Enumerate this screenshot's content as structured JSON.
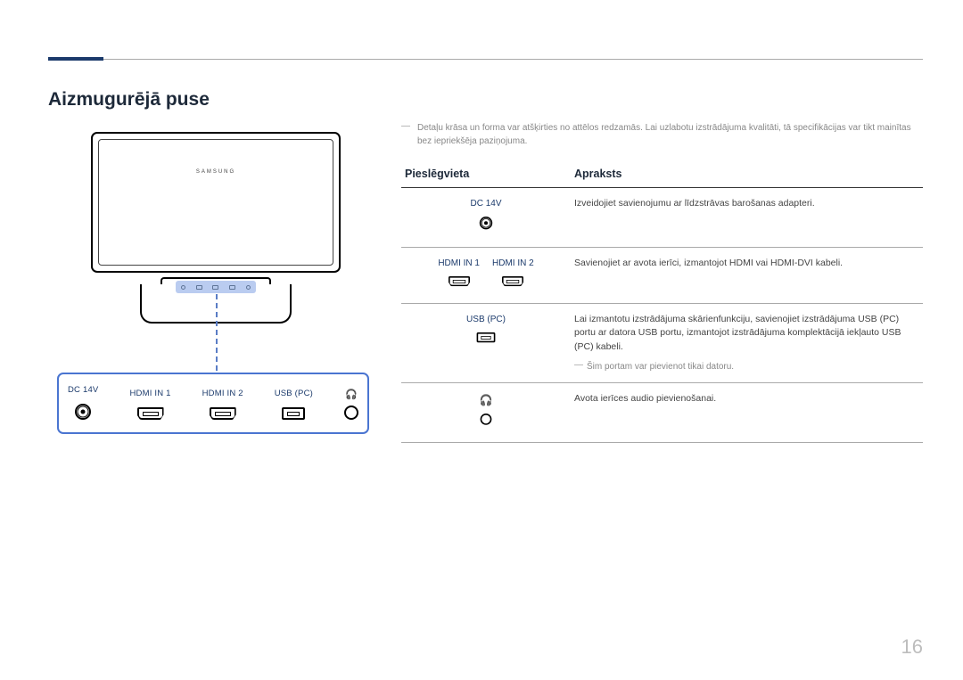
{
  "page": {
    "title": "Aizmugurējā puse",
    "page_number": "16",
    "brand_on_monitor": "SAMSUNG"
  },
  "top_note": "Detaļu krāsa un forma var atšķirties no attēlos redzamās. Lai uzlabotu izstrādājuma kvalitāti, tā specifikācijas var tikt mainītas bez iepriekšēja paziņojuma.",
  "ports_panel": {
    "items": [
      {
        "label": "DC 14V",
        "kind": "dc"
      },
      {
        "label": "HDMI IN 1",
        "kind": "hdmi"
      },
      {
        "label": "HDMI IN 2",
        "kind": "hdmi"
      },
      {
        "label": "USB (PC)",
        "kind": "usb"
      },
      {
        "label": "",
        "kind": "hp"
      }
    ]
  },
  "table": {
    "headers": {
      "port": "Pieslēgvieta",
      "desc": "Apraksts"
    },
    "rows": [
      {
        "port_labels": [
          "DC 14V"
        ],
        "port_kinds": [
          "dc"
        ],
        "desc": "Izveidojiet savienojumu ar līdzstrāvas barošanas adapteri.",
        "desc_note": ""
      },
      {
        "port_labels": [
          "HDMI IN 1",
          "HDMI IN 2"
        ],
        "port_kinds": [
          "hdmi",
          "hdmi"
        ],
        "desc": "Savienojiet ar avota ierīci, izmantojot HDMI vai HDMI-DVI kabeli.",
        "desc_note": ""
      },
      {
        "port_labels": [
          "USB (PC)"
        ],
        "port_kinds": [
          "usb"
        ],
        "desc": "Lai izmantotu izstrādājuma skārienfunkciju, savienojiet izstrādājuma USB (PC) portu ar datora USB portu, izmantojot izstrādājuma komplektācijā iekļauto USB (PC) kabeli.",
        "desc_note": "Šim portam var pievienot tikai datoru."
      },
      {
        "port_labels": [
          ""
        ],
        "port_kinds": [
          "hp"
        ],
        "desc": "Avota ierīces audio pievienošanai.",
        "desc_note": ""
      }
    ]
  }
}
